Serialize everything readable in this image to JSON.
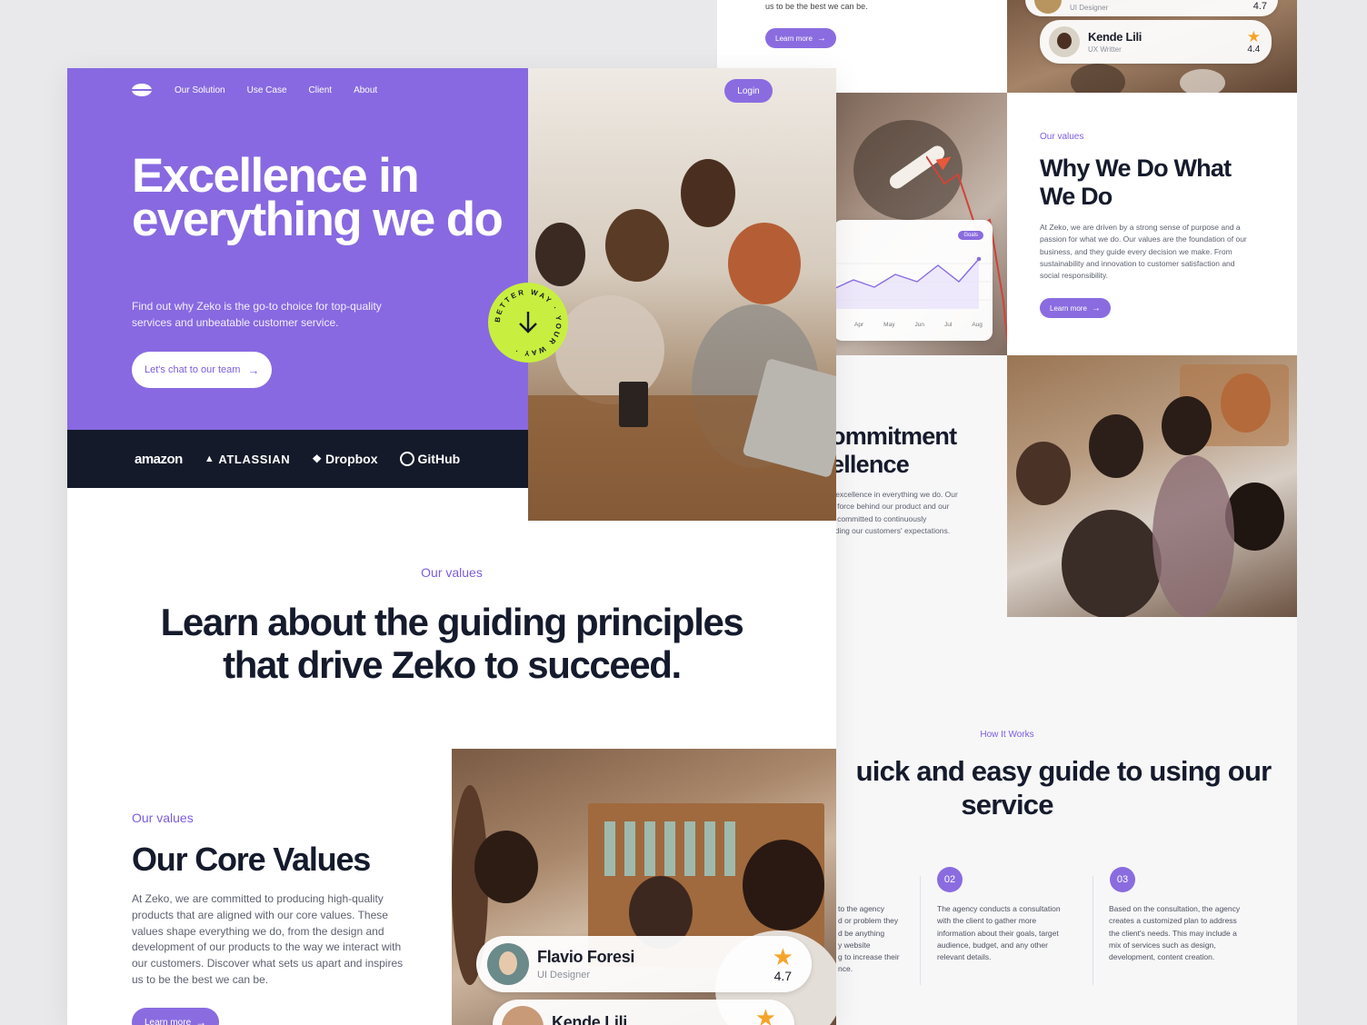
{
  "colors": {
    "accent": "#8869e1",
    "dark": "#141a29",
    "lime": "#c8ef3f",
    "star": "#f6a428"
  },
  "back": {
    "top_text": "us to be the best we can be.",
    "top_btn": "Learn more",
    "reviews_top": [
      {
        "name": "",
        "role": "UI Designer",
        "score": "4.7"
      },
      {
        "name": "Kende Lili",
        "role": "UX Writter",
        "score": "4.4"
      }
    ],
    "chart": {
      "badge": "Goals",
      "months": [
        "Apr",
        "May",
        "Jun",
        "Jul",
        "Aug"
      ]
    },
    "why": {
      "eyebrow": "Our values",
      "title": "Why We Do What We Do",
      "body": "At Zeko, we are driven by a strong sense of purpose and a passion for what we do. Our values are the foundation of our business, and they guide every decision we make. From sustainability and innovation to customer satisfaction and social responsibility.",
      "btn": "Learn more"
    },
    "commitment": {
      "title_line1": "ommitment",
      "title_line2": "ellence",
      "body_lines": [
        "r excellence in everything we do. Our",
        "g force behind our product and our",
        "e committed to continuously",
        "eding our customers' expectations."
      ]
    },
    "how": {
      "eyebrow": "How It Works",
      "title_line1": "uick and easy guide to using our",
      "title_line2": "service",
      "step1_lines": [
        "to the agency",
        "d or problem they",
        "d be anything",
        "y website",
        "g to increase their",
        "nce."
      ],
      "steps": [
        {
          "num": "02",
          "text": "The agency conducts a consultation with the client to gather more information about their goals, target audience, budget, and any other relevant details."
        },
        {
          "num": "03",
          "text": "Based on the consultation, the agency creates a customized plan to address the client's needs. This may include a mix of services such as design, development, content creation."
        }
      ]
    }
  },
  "front": {
    "nav": [
      "Our Solution",
      "Use Case",
      "Client",
      "About"
    ],
    "login": "Login",
    "hero_title": "Excellence in everything we do",
    "hero_sub": "Find out why Zeko is the go-to choice for top-quality services and unbeatable customer service.",
    "cta": "Let's chat to our team",
    "badge_text": "BETTER WAY · YOUR WAY ·",
    "partners": [
      "amazon",
      "ATLASSIAN",
      "Dropbox",
      "GitHub"
    ],
    "values": {
      "eyebrow": "Our values",
      "title_line1": "Learn about the guiding principles",
      "title_line2": "that drive Zeko to succeed."
    },
    "core": {
      "eyebrow": "Our values",
      "title": "Our Core Values",
      "body": "At Zeko, we are committed to producing high-quality products that are aligned with our core values. These values shape everything we do, from the design and development of our products to the way we interact with our customers. Discover what sets us apart and inspires us to be the best we can be.",
      "btn": "Learn more"
    },
    "reviews": [
      {
        "name": "Flavio Foresi",
        "role": "UI Designer",
        "score": "4.7"
      },
      {
        "name": "Kende Lili",
        "role": "",
        "score": ""
      }
    ]
  }
}
